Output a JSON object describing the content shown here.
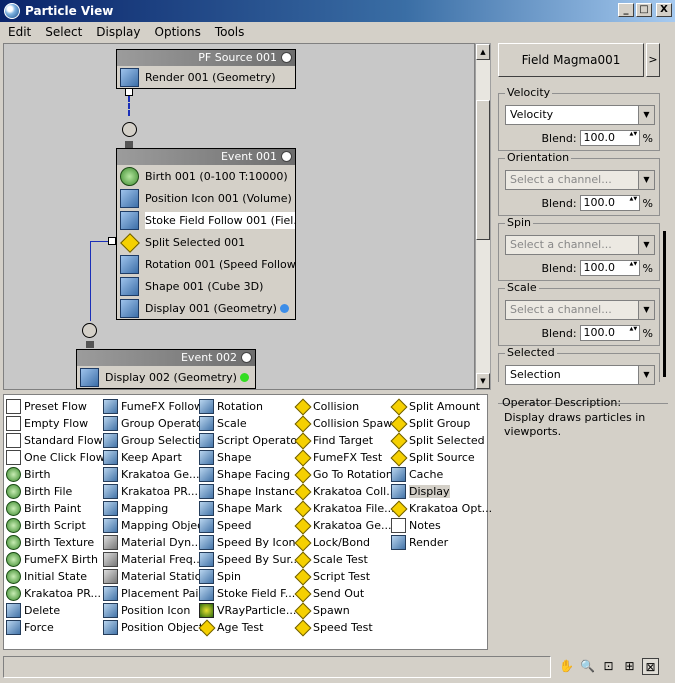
{
  "window": {
    "title": "Particle View",
    "controls": [
      "_",
      "□",
      "X"
    ]
  },
  "menu": [
    "Edit",
    "Select",
    "Display",
    "Options",
    "Tools"
  ],
  "graph": {
    "pf_source": {
      "title": "PF Source 001",
      "operators": [
        {
          "label": "Render 001 (Geometry)",
          "icon": "render-icon"
        }
      ]
    },
    "event1": {
      "title": "Event 001",
      "operators": [
        {
          "label": "Birth 001 (0-100 T:10000)",
          "icon": "birth-icon"
        },
        {
          "label": "Position Icon 001 (Volume)",
          "icon": "position-icon"
        },
        {
          "label": "Stoke Field Follow 001 (Fiel...",
          "icon": "stoke-icon"
        },
        {
          "label": "Split Selected 001",
          "icon": "split-test-icon"
        },
        {
          "label": "Rotation 001 (Speed Follow)",
          "icon": "rotation-icon"
        },
        {
          "label": "Shape 001 (Cube 3D)",
          "icon": "shape-icon"
        },
        {
          "label": "Display 001 (Geometry)",
          "icon": "display-icon"
        }
      ],
      "display_color": "#3d8ee8"
    },
    "event2": {
      "title": "Event 002",
      "operators": [
        {
          "label": "Display 002 (Geometry)",
          "icon": "display-icon"
        }
      ],
      "display_color": "#33dd22"
    }
  },
  "params": {
    "field_name": "Field Magma001",
    "field_arrow": ">",
    "groups": [
      {
        "title": "Velocity",
        "channel": "Velocity",
        "disabled": false,
        "blend_label": "Blend:",
        "blend": "100.0",
        "unit": "%"
      },
      {
        "title": "Orientation",
        "channel": "Select a channel...",
        "disabled": true,
        "blend_label": "Blend:",
        "blend": "100.0",
        "unit": "%"
      },
      {
        "title": "Spin",
        "channel": "Select a channel...",
        "disabled": true,
        "blend_label": "Blend:",
        "blend": "100.0",
        "unit": "%"
      },
      {
        "title": "Scale",
        "channel": "Select a channel...",
        "disabled": true,
        "blend_label": "Blend:",
        "blend": "100.0",
        "unit": "%"
      },
      {
        "title": "Selected",
        "channel": "Selection",
        "disabled": false
      }
    ]
  },
  "depot": {
    "columns": [
      [
        {
          "label": "Preset Flow",
          "icon": "flow"
        },
        {
          "label": "Empty Flow",
          "icon": "flow"
        },
        {
          "label": "Standard Flow",
          "icon": "flow"
        },
        {
          "label": "One Click Flow",
          "icon": "flow"
        },
        {
          "label": "Birth",
          "icon": "green"
        },
        {
          "label": "Birth File",
          "icon": "green"
        },
        {
          "label": "Birth Paint",
          "icon": "green"
        },
        {
          "label": "Birth Script",
          "icon": "green"
        },
        {
          "label": "Birth Texture",
          "icon": "green"
        },
        {
          "label": "FumeFX Birth",
          "icon": "green"
        },
        {
          "label": "Initial State",
          "icon": "green"
        },
        {
          "label": "Krakatoa PR...",
          "icon": "green"
        },
        {
          "label": "Delete",
          "icon": "blue"
        },
        {
          "label": "Force",
          "icon": "blue"
        }
      ],
      [
        {
          "label": "FumeFX Follow",
          "icon": "blue"
        },
        {
          "label": "Group Operator",
          "icon": "blue"
        },
        {
          "label": "Group Selection",
          "icon": "blue"
        },
        {
          "label": "Keep Apart",
          "icon": "blue"
        },
        {
          "label": "Krakatoa Ge...",
          "icon": "blue"
        },
        {
          "label": "Krakatoa PR...",
          "icon": "blue"
        },
        {
          "label": "Mapping",
          "icon": "blue"
        },
        {
          "label": "Mapping Object",
          "icon": "blue"
        },
        {
          "label": "Material Dyn...",
          "icon": "gray"
        },
        {
          "label": "Material Freq...",
          "icon": "gray"
        },
        {
          "label": "Material Static",
          "icon": "gray"
        },
        {
          "label": "Placement Paint",
          "icon": "blue"
        },
        {
          "label": "Position Icon",
          "icon": "blue"
        },
        {
          "label": "Position Object",
          "icon": "blue"
        }
      ],
      [
        {
          "label": "Rotation",
          "icon": "blue"
        },
        {
          "label": "Scale",
          "icon": "blue"
        },
        {
          "label": "Script Operator",
          "icon": "blue"
        },
        {
          "label": "Shape",
          "icon": "blue"
        },
        {
          "label": "Shape Facing",
          "icon": "blue"
        },
        {
          "label": "Shape Instance",
          "icon": "blue"
        },
        {
          "label": "Shape Mark",
          "icon": "blue"
        },
        {
          "label": "Speed",
          "icon": "blue"
        },
        {
          "label": "Speed By Icon",
          "icon": "blue"
        },
        {
          "label": "Speed By Sur...",
          "icon": "blue"
        },
        {
          "label": "Spin",
          "icon": "blue"
        },
        {
          "label": "Stoke Field F...",
          "icon": "blue"
        },
        {
          "label": "VRayParticle...",
          "icon": "vray"
        },
        {
          "label": "Age Test",
          "icon": "diamond"
        }
      ],
      [
        {
          "label": "Collision",
          "icon": "diamond"
        },
        {
          "label": "Collision Spawn",
          "icon": "diamond"
        },
        {
          "label": "Find Target",
          "icon": "diamond"
        },
        {
          "label": "FumeFX Test",
          "icon": "diamond"
        },
        {
          "label": "Go To Rotation",
          "icon": "diamond"
        },
        {
          "label": "Krakatoa Coll...",
          "icon": "diamond"
        },
        {
          "label": "Krakatoa File...",
          "icon": "diamond"
        },
        {
          "label": "Krakatoa Ge...",
          "icon": "diamond"
        },
        {
          "label": "Lock/Bond",
          "icon": "diamond"
        },
        {
          "label": "Scale Test",
          "icon": "diamond"
        },
        {
          "label": "Script Test",
          "icon": "diamond"
        },
        {
          "label": "Send Out",
          "icon": "diamond"
        },
        {
          "label": "Spawn",
          "icon": "diamond"
        },
        {
          "label": "Speed Test",
          "icon": "diamond"
        }
      ],
      [
        {
          "label": "Split Amount",
          "icon": "diamond"
        },
        {
          "label": "Split Group",
          "icon": "diamond"
        },
        {
          "label": "Split Selected",
          "icon": "diamond"
        },
        {
          "label": "Split Source",
          "icon": "diamond"
        },
        {
          "label": "Cache",
          "icon": "blue"
        },
        {
          "label": "Display",
          "icon": "blue",
          "selected": true
        },
        {
          "label": "Krakatoa Opt...",
          "icon": "diamond"
        },
        {
          "label": "Notes",
          "icon": "flow"
        },
        {
          "label": "Render",
          "icon": "blue"
        }
      ]
    ]
  },
  "description": {
    "title": "Operator Description:",
    "text": "Display draws particles in viewports."
  },
  "toolbar": [
    "pan-icon",
    "zoom-icon",
    "zoom-region-icon",
    "zoom-extents-icon",
    "no-zoom-icon"
  ],
  "toolbar_glyphs": [
    "✋",
    "🔍",
    "⊡",
    "⊞",
    "⊠"
  ]
}
